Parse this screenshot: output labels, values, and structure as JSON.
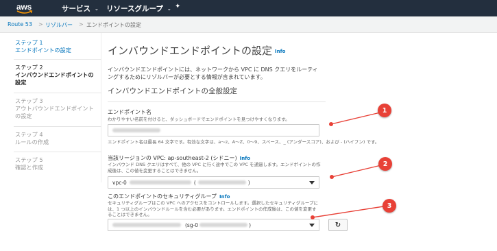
{
  "nav": {
    "logo": "aws",
    "services": "サービス",
    "resource_groups": "リソースグループ",
    "caret": "⌄",
    "pin": "✦"
  },
  "breadcrumb": {
    "items": [
      "Route 53",
      "リゾルバー",
      "エンドポイントの設定"
    ],
    "separator": ">"
  },
  "sidebar": {
    "steps": [
      {
        "num": "ステップ 1",
        "name": "エンドポイントの設定",
        "state": "done"
      },
      {
        "num": "ステップ 2",
        "name": "インバウンドエンドポイントの設定",
        "state": "active"
      },
      {
        "num": "ステップ 3",
        "name": "アウトバウンドエンドポイントの設定",
        "state": "todo"
      },
      {
        "num": "ステップ 4",
        "name": "ルールの作成",
        "state": "todo"
      },
      {
        "num": "ステップ 5",
        "name": "確認と作成",
        "state": "todo"
      }
    ]
  },
  "main": {
    "title": "インバウンドエンドポイントの設定",
    "info": "Info",
    "description": "インバウンドエンドポイントには、ネットワークから VPC に DNS クエリをルーティングするためにリゾルバーが必要とする情報が含まれています。",
    "section_title": "インバウンドエンドポイントの全般設定",
    "endpoint_name": {
      "label": "エンドポイント名",
      "hint": "わかりやすい名前を付けると、ダッシュボードでエンドポイントを見つけやすくなります。",
      "constraint": "エンドポイント名は最長 64 文字です。有効な文字は、a〜z、A〜Z、0〜9、スペース、_ (アンダースコア)、および - (ハイフン) です。"
    },
    "vpc": {
      "label": "当該リージョンの VPC: ap-southeast-2 (シドニー)",
      "info": "Info",
      "hint": "インバウンド DNS クエリはすべて、他の VPC に行く途中でこの VPC を通過します。エンドポイントの作成後は、この値を変更することはできません。",
      "value_prefix": "vpc-0",
      "value_mid": "(",
      "value_end": ")"
    },
    "security_group": {
      "label": "このエンドポイントのセキュリティグループ",
      "info": "Info",
      "hint": "セキュリティグループはこの VPC へのアクセスをコントロールします。選択したセキュリティグループには、1 つ以上のインバウンドルールを含む必要があります。エンドポイントの作成後は、この値を変更することはできません。",
      "value_mid": "(sg-0",
      "value_end": ")"
    },
    "refresh_icon": "↻"
  },
  "callouts": [
    "1",
    "2",
    "3"
  ],
  "colors": {
    "nav_bg": "#232f3e",
    "link": "#0073bb",
    "callout": "#e84137"
  }
}
